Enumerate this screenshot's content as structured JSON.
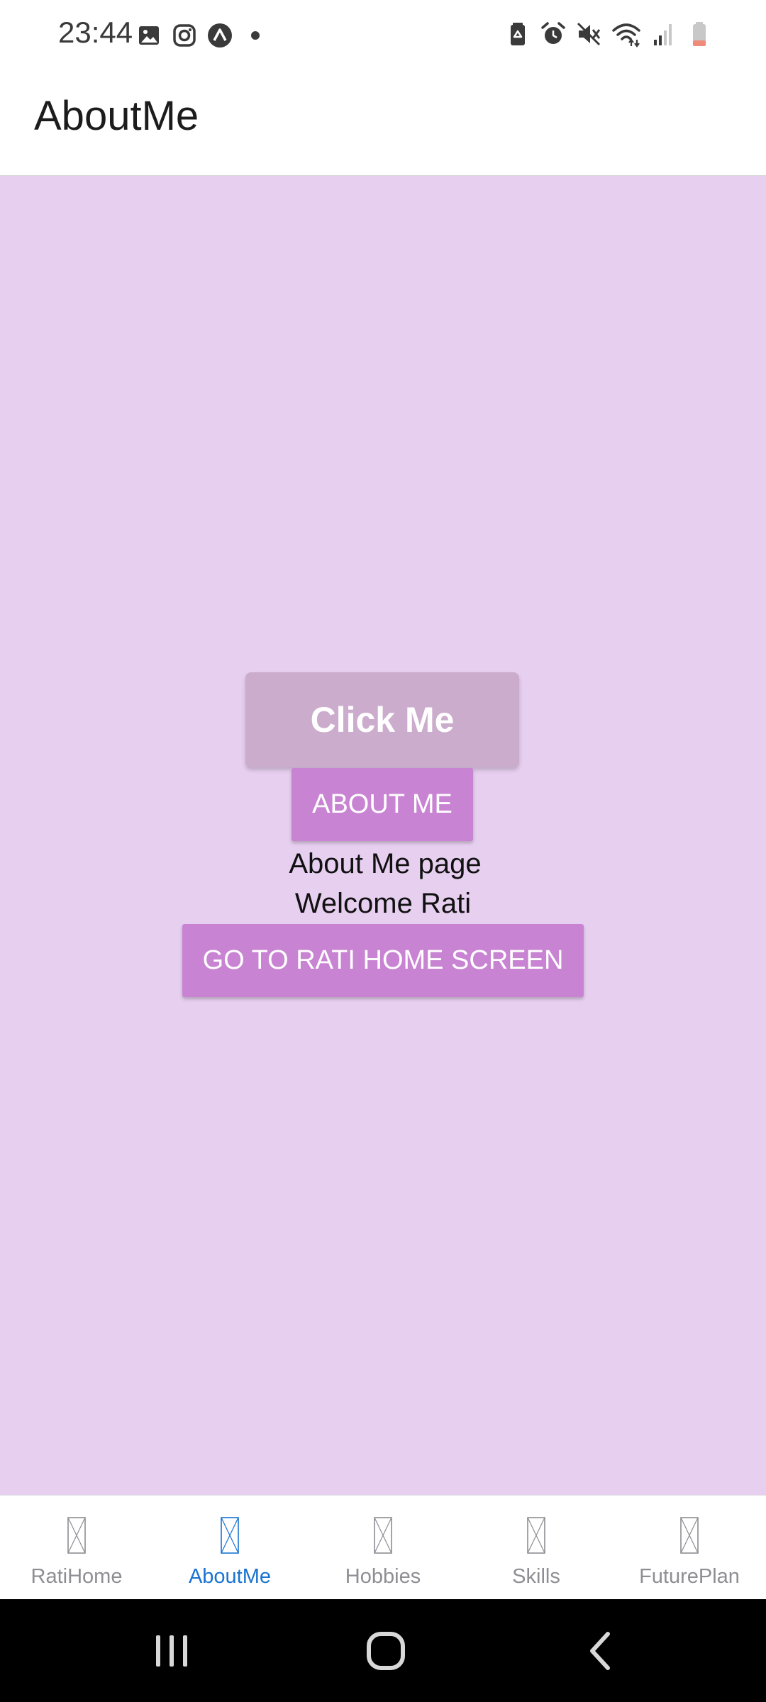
{
  "status_bar": {
    "time": "23:44",
    "left_icons": [
      "gallery-icon",
      "instagram-icon",
      "expo-icon",
      "notification-dot-icon"
    ],
    "right_icons": [
      "battery-saver-icon",
      "alarm-icon",
      "mute-icon",
      "wifi-icon",
      "signal-icon",
      "battery-icon"
    ]
  },
  "header": {
    "title": "AboutMe"
  },
  "main": {
    "click_me_label": "Click Me",
    "about_me_label": "ABOUT ME",
    "about_text": "About Me page",
    "welcome_text": "Welcome Rati",
    "home_button_label": "GO TO RATI HOME SCREEN"
  },
  "tabs": [
    {
      "label": "RatiHome",
      "icon": "missing-glyph-icon",
      "active": false
    },
    {
      "label": "AboutMe",
      "icon": "missing-glyph-icon",
      "active": true
    },
    {
      "label": "Hobbies",
      "icon": "missing-glyph-icon",
      "active": false
    },
    {
      "label": "Skills",
      "icon": "missing-glyph-icon",
      "active": false
    },
    {
      "label": "FuturePlan",
      "icon": "missing-glyph-icon",
      "active": false
    }
  ],
  "system_nav": [
    "recents-icon",
    "home-icon",
    "back-icon"
  ],
  "colors": {
    "content_background": "#e7cff0",
    "primary_button": "#c884d2",
    "disabled_button": "#ccaccc",
    "active_tab": "#1a73d1",
    "inactive_tab": "#8e8e93"
  }
}
